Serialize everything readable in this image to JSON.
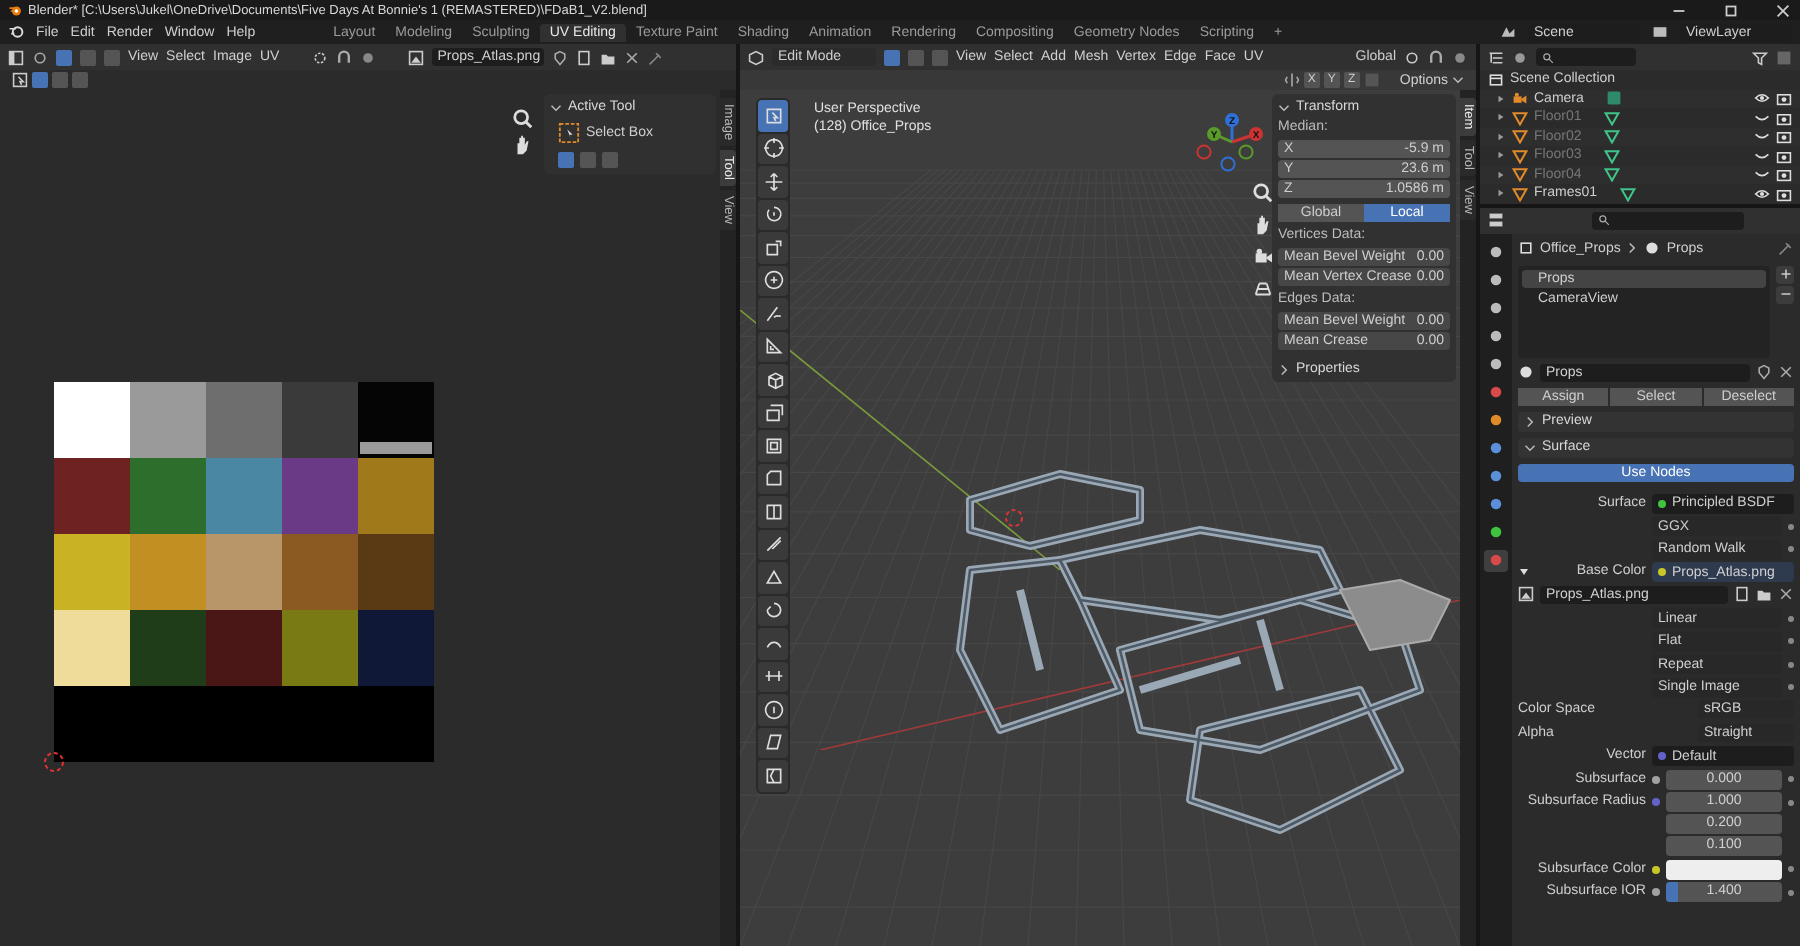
{
  "window": {
    "title": "Blender* [C:\\Users\\Jukel\\OneDrive\\Documents\\Five Days At Bonnie's 1 (REMASTERED)\\FDaB1_V2.blend]"
  },
  "menu": [
    "File",
    "Edit",
    "Render",
    "Window",
    "Help"
  ],
  "workspaces": [
    {
      "label": "Layout",
      "selected": false
    },
    {
      "label": "Modeling",
      "selected": false
    },
    {
      "label": "Sculpting",
      "selected": false
    },
    {
      "label": "UV Editing",
      "selected": true
    },
    {
      "label": "Texture Paint",
      "selected": false
    },
    {
      "label": "Shading",
      "selected": false
    },
    {
      "label": "Animation",
      "selected": false
    },
    {
      "label": "Rendering",
      "selected": false
    },
    {
      "label": "Compositing",
      "selected": false
    },
    {
      "label": "Geometry Nodes",
      "selected": false
    },
    {
      "label": "Scripting",
      "selected": false
    }
  ],
  "add_workspace": "+",
  "scene": "Scene",
  "view_layer": "ViewLayer",
  "uv_editor": {
    "menus": [
      "View",
      "Select",
      "Image",
      "UV"
    ],
    "image": "Props_Atlas.png",
    "select_modes": [
      {
        "selected": true
      },
      {
        "selected": false
      },
      {
        "selected": false
      }
    ],
    "side_tabs": [
      {
        "label": "Image",
        "selected": false
      },
      {
        "label": "Tool",
        "selected": true
      },
      {
        "label": "View",
        "selected": false
      }
    ],
    "active_tool": {
      "title": "Active Tool",
      "expanded": true,
      "tool": "Select Box",
      "modes": [
        {
          "selected": true
        },
        {
          "selected": false
        },
        {
          "selected": false
        }
      ]
    }
  },
  "viewport": {
    "mode": "Edit Mode",
    "select_modes": [
      {
        "selected": true
      },
      {
        "selected": false
      },
      {
        "selected": false
      }
    ],
    "menus": [
      "View",
      "Select",
      "Add",
      "Mesh",
      "Vertex",
      "Edge",
      "Face",
      "UV"
    ],
    "orientation": "Global",
    "mirror_axes": [
      "X",
      "Y",
      "Z"
    ],
    "options": "Options",
    "perspective": "User Perspective",
    "object": "(128) Office_Props",
    "gizmo": [
      "Z",
      "Y",
      "X"
    ],
    "tools": [
      {
        "kind": "select",
        "selected": true
      },
      {
        "kind": "cursor",
        "selected": false
      },
      {
        "kind": "move",
        "selected": false
      },
      {
        "kind": "rotate",
        "selected": false
      },
      {
        "kind": "scale",
        "selected": false
      },
      {
        "kind": "transform",
        "selected": false
      },
      {
        "kind": "annotate",
        "selected": false
      },
      {
        "kind": "measure",
        "selected": false
      },
      {
        "kind": "cube",
        "selected": false
      },
      {
        "kind": "extrude",
        "selected": false
      },
      {
        "kind": "inset",
        "selected": false
      },
      {
        "kind": "bevel",
        "selected": false
      },
      {
        "kind": "loopcut",
        "selected": false
      },
      {
        "kind": "knife",
        "selected": false
      },
      {
        "kind": "polybuild",
        "selected": false
      },
      {
        "kind": "spin",
        "selected": false
      },
      {
        "kind": "smooth",
        "selected": false
      },
      {
        "kind": "slide",
        "selected": false
      },
      {
        "kind": "shrink",
        "selected": false
      },
      {
        "kind": "shear",
        "selected": false
      },
      {
        "kind": "rip",
        "selected": false
      }
    ],
    "transform": {
      "title": "Transform",
      "expanded": true,
      "median": "Median:",
      "fields": [
        {
          "label": "X",
          "value": "-5.9 m"
        },
        {
          "label": "Y",
          "value": "23.6 m"
        },
        {
          "label": "Z",
          "value": "1.0586 m"
        }
      ],
      "space": [
        {
          "label": "Global",
          "selected": false
        },
        {
          "label": "Local",
          "selected": true
        }
      ],
      "vertices_title": "Vertices Data:",
      "vertices": [
        {
          "label": "Mean Bevel Weight",
          "value": "0.00"
        },
        {
          "label": "Mean Vertex Crease",
          "value": "0.00"
        }
      ],
      "edges_title": "Edges Data:",
      "edges": [
        {
          "label": "Mean Bevel Weight",
          "value": "0.00"
        },
        {
          "label": "Mean Crease",
          "value": "0.00"
        }
      ],
      "properties": {
        "title": "Properties",
        "expanded": false
      }
    },
    "side_tabs": [
      {
        "label": "Item",
        "selected": true
      },
      {
        "label": "Tool",
        "selected": false
      },
      {
        "label": "View",
        "selected": false
      }
    ]
  },
  "outliner": {
    "root": "Scene Collection",
    "objects": [
      {
        "name": "Camera",
        "kind": "camera",
        "visible": true
      },
      {
        "name": "Floor01",
        "kind": "mesh",
        "visible": false
      },
      {
        "name": "Floor02",
        "kind": "mesh",
        "visible": false
      },
      {
        "name": "Floor03",
        "kind": "mesh",
        "visible": false
      },
      {
        "name": "Floor04",
        "kind": "mesh",
        "visible": false
      },
      {
        "name": "Frames01",
        "kind": "mesh",
        "visible": true
      }
    ]
  },
  "properties": {
    "tabs": [
      {
        "kind": "tool",
        "selected": false
      },
      {
        "kind": "render",
        "selected": false
      },
      {
        "kind": "output",
        "selected": false
      },
      {
        "kind": "view_layer",
        "selected": false
      },
      {
        "kind": "scene",
        "selected": false
      },
      {
        "kind": "world",
        "selected": false
      },
      {
        "kind": "object",
        "selected": false
      },
      {
        "kind": "modifier",
        "selected": false
      },
      {
        "kind": "particles",
        "selected": false
      },
      {
        "kind": "physics",
        "selected": false
      },
      {
        "kind": "data",
        "selected": false
      },
      {
        "kind": "material",
        "selected": true
      }
    ],
    "breadcrumb": [
      "Office_Props",
      "Props"
    ],
    "slots": [
      {
        "name": "Props",
        "selected": true
      },
      {
        "name": "CameraView",
        "selected": false
      }
    ],
    "material": "Props",
    "slot_buttons": [
      "Assign",
      "Select",
      "Deselect"
    ],
    "panels": [
      {
        "title": "Preview",
        "expanded": false
      },
      {
        "title": "Surface",
        "expanded": true
      }
    ],
    "use_nodes": "Use Nodes",
    "rows": [
      {
        "kind": "socket",
        "label": "Surface",
        "value": "Principled BSDF",
        "color": "#3fc43f"
      },
      {
        "kind": "dropdown",
        "value": "GGX"
      },
      {
        "kind": "dropdown",
        "value": "Random Walk"
      },
      {
        "kind": "socket",
        "label": "Base Color",
        "value": "Props_Atlas.png",
        "color": "#c7c729",
        "expanded": true
      },
      {
        "kind": "image",
        "value": "Props_Atlas.png"
      },
      {
        "kind": "dropdown",
        "value": "Linear"
      },
      {
        "kind": "dropdown",
        "value": "Flat"
      },
      {
        "kind": "dropdown",
        "value": "Repeat"
      },
      {
        "kind": "dropdown",
        "value": "Single Image"
      },
      {
        "kind": "labeled",
        "label": "Color Space",
        "value": "sRGB"
      },
      {
        "kind": "labeled",
        "label": "Alpha",
        "value": "Straight"
      },
      {
        "kind": "socket",
        "label": "Vector",
        "value": "Default",
        "color": "#6363c7"
      },
      {
        "kind": "number",
        "label": "Subsurface",
        "values": [
          "0.000"
        ],
        "color": "#a1a1a1"
      },
      {
        "kind": "number",
        "label": "Subsurface Radius",
        "values": [
          "1.000",
          "0.200",
          "0.100"
        ],
        "color": "#6363c7"
      },
      {
        "kind": "color",
        "label": "Subsurface Color",
        "color": "#c7c729"
      },
      {
        "kind": "slider",
        "label": "Subsurface IOR",
        "value": "1.400",
        "level": 0.1,
        "color": "#a1a1a1"
      }
    ]
  }
}
